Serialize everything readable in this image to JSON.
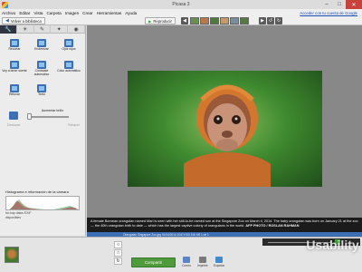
{
  "window": {
    "title": "Picasa 3",
    "controls": [
      "minimize",
      "maximize",
      "close"
    ]
  },
  "menu": {
    "items": [
      "Archivo",
      "Editar",
      "Vista",
      "Carpeta",
      "Imagen",
      "Crear",
      "Herramientas",
      "Ayuda"
    ],
    "signin_link": "Acceder con tu cuenta de Google"
  },
  "toolbar": {
    "back_label": "Volver a biblioteca",
    "play_label": "Reproducir"
  },
  "left_panel": {
    "tabs": [
      "wrench-icon",
      "sun-icon",
      "brush-icon",
      "wand-icon",
      "eye-icon"
    ],
    "tools": [
      {
        "label": "Recortar",
        "icon": "crop-icon"
      },
      {
        "label": "Enderezar",
        "icon": "straighten-icon"
      },
      {
        "label": "Ojos rojos",
        "icon": "red-eye-icon"
      },
      {
        "label": "Voy a tener suerte",
        "icon": "lucky-icon"
      },
      {
        "label": "Contraste automático",
        "icon": "auto-contrast-icon"
      },
      {
        "label": "Color automático",
        "icon": "auto-color-icon"
      },
      {
        "label": "Retocar",
        "icon": "retouch-icon"
      },
      {
        "label": "Texto",
        "icon": "text-icon"
      }
    ],
    "fill_light_label": "Aumentar brillo",
    "fill_light_level": 0,
    "undo_label": "Deshacer",
    "redo_label": "Rehacer",
    "histogram_title": "Histograma e información de la cámara",
    "exif_line1": "No hay datos EXIF",
    "exif_line2": "disponibles"
  },
  "photo": {
    "subject": "young orangutan"
  },
  "caption": {
    "text": "A female Bornean orangutan named Mari is seen with her still-to-be named son at the Singapore Zoo on March 4, 2014. The baby orangutan was born on January 21 at the zoo — the 40th orangutan birth to date — which has the largest captive colony of orangutans in the world.",
    "credit": "AFP PHOTO / ROSLAN RAHMAN"
  },
  "status": {
    "text": "Orangutan Singapore Zoo.jpg   01/04/2014   1047x700   316 KB   1 de 1"
  },
  "bottom": {
    "share_label": "Compartir",
    "actions": [
      {
        "label": "Correo",
        "icon": "email-icon"
      },
      {
        "label": "Imprimir",
        "icon": "print-icon"
      },
      {
        "label": "Exportar",
        "icon": "export-icon"
      }
    ]
  },
  "watermark": "Usability",
  "colors": {
    "accent": "#3d6fb5",
    "share": "#4f9a3a",
    "close": "#c8423c"
  }
}
